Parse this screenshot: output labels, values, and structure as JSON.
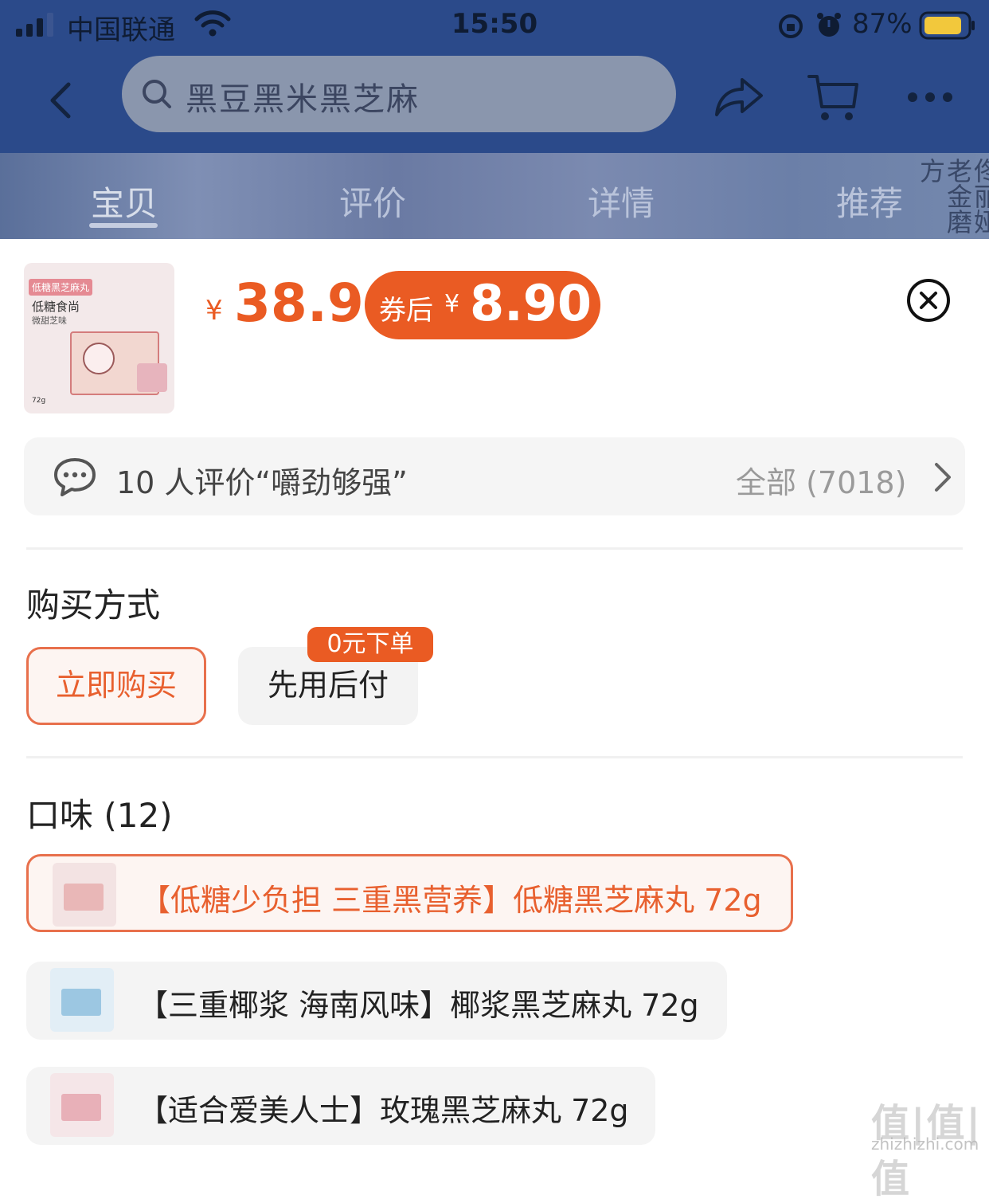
{
  "status_bar": {
    "carrier": "中国联通",
    "time": "15:50",
    "battery": "87%"
  },
  "nav": {
    "search_placeholder": "黑豆黑米黑芝麻"
  },
  "tabs": [
    {
      "label": "宝贝",
      "active": true
    },
    {
      "label": "评价",
      "active": false
    },
    {
      "label": "详情",
      "active": false
    },
    {
      "label": "推荐",
      "active": false
    }
  ],
  "banner_brand_text": "佟丽娅老金磨方",
  "product": {
    "thumb_badge": "低糖黑芝麻丸",
    "thumb_title": "低糖食尚",
    "thumb_sub": "微甜芝味",
    "thumb_weight": "72g",
    "price_symbol": "¥",
    "price": "38.9",
    "coupon_label": "券后",
    "coupon_symbol": "¥",
    "coupon_price": "8.90"
  },
  "review": {
    "summary": "10 人评价“嚼劲够强”",
    "all_label": "全部 (7018)"
  },
  "purchase": {
    "title": "购买方式",
    "buy_now": "立即购买",
    "pay_later": "先用后付",
    "pay_later_badge": "0元下单"
  },
  "flavors": {
    "title": "口味 (12)",
    "items": [
      {
        "label": "【低糖少负担 三重黑营养】低糖黑芝麻丸 72g",
        "selected": true,
        "thumb_color": "#f3e3e3",
        "box_color": "#e9b7b7"
      },
      {
        "label": "【三重椰浆 海南风味】椰浆黑芝麻丸 72g",
        "selected": false,
        "thumb_color": "#e2eef6",
        "box_color": "#9cc7e2"
      },
      {
        "label": "【适合爱美人士】玫瑰黑芝麻丸 72g",
        "selected": false,
        "thumb_color": "#f5e6e8",
        "box_color": "#e8b0b8"
      }
    ]
  },
  "watermark": {
    "main": "值|值|值",
    "sub": "zhizhizhi.com"
  }
}
